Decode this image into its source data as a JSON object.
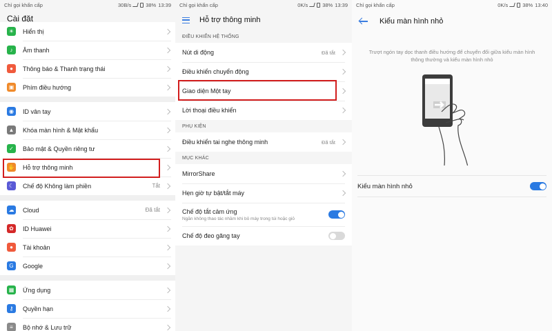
{
  "panel1": {
    "status": {
      "left": "Chỉ gọi khẩn cấp",
      "speed": "30B/s",
      "battery": "38%",
      "time": "13:39"
    },
    "title": "Cài đặt",
    "groups": [
      [
        {
          "label": "Hiển thị",
          "icon": "display-icon",
          "color": "#27b34b",
          "glyph": "☀"
        },
        {
          "label": "Âm thanh",
          "icon": "sound-icon",
          "color": "#27b34b",
          "glyph": "♪"
        },
        {
          "label": "Thông báo & Thanh trạng thái",
          "icon": "notification-icon",
          "color": "#f05a3c",
          "glyph": "●"
        },
        {
          "label": "Phím điều hướng",
          "icon": "nav-keys-icon",
          "color": "#f08a2a",
          "glyph": "▣"
        }
      ],
      [
        {
          "label": "ID vân tay",
          "icon": "fingerprint-icon",
          "color": "#2a7ae2",
          "glyph": "◉"
        },
        {
          "label": "Khóa màn hình & Mật khẩu",
          "icon": "lock-icon",
          "color": "#7a7a7a",
          "glyph": "▲"
        },
        {
          "label": "Bảo mật & Quyền riêng tư",
          "icon": "shield-icon",
          "color": "#27b34b",
          "glyph": "✓"
        },
        {
          "label": "Hỗ trợ thông minh",
          "icon": "hand-icon",
          "color": "#f08a2a",
          "glyph": "✋"
        },
        {
          "label": "Chế độ Không làm phiền",
          "icon": "moon-icon",
          "color": "#5a5ad6",
          "glyph": "☾",
          "value": "Tắt"
        }
      ],
      [
        {
          "label": "Cloud",
          "icon": "cloud-icon",
          "color": "#2a7ae2",
          "glyph": "☁",
          "value": "Đã tắt"
        },
        {
          "label": "ID Huawei",
          "icon": "huawei-icon",
          "color": "#d42828",
          "glyph": "✿"
        },
        {
          "label": "Tài khoản",
          "icon": "account-icon",
          "color": "#f05a3c",
          "glyph": "●"
        },
        {
          "label": "Google",
          "icon": "google-icon",
          "color": "#2a7ae2",
          "glyph": "G"
        }
      ],
      [
        {
          "label": "Ứng dụng",
          "icon": "apps-icon",
          "color": "#27b34b",
          "glyph": "▦"
        },
        {
          "label": "Quyền hạn",
          "icon": "key-icon",
          "color": "#2a7ae2",
          "glyph": "⚷"
        },
        {
          "label": "Bộ nhớ & Lưu trữ",
          "icon": "storage-icon",
          "color": "#8a8a8a",
          "glyph": "≡"
        }
      ]
    ]
  },
  "panel2": {
    "status": {
      "left": "Chỉ gọi khẩn cấp",
      "speed": "0K/s",
      "battery": "38%",
      "time": "13:39"
    },
    "title": "Hỗ trợ thông minh",
    "sections": [
      {
        "header": "ĐIỀU KHIỂN HỆ THỐNG",
        "rows": [
          {
            "label": "Nút di động",
            "value": "Đã tắt"
          },
          {
            "label": "Điều khiển chuyển động"
          },
          {
            "label": "Giao diện Một tay"
          },
          {
            "label": "Lời thoại điều khiển"
          }
        ]
      },
      {
        "header": "PHỤ KIỆN",
        "rows": [
          {
            "label": "Điều khiển tai nghe thông minh",
            "value": "Đã tắt"
          }
        ]
      },
      {
        "header": "MỤC KHÁC",
        "rows": [
          {
            "label": "MirrorShare"
          },
          {
            "label": "Hẹn giờ tự bật/tắt máy"
          },
          {
            "label": "Chế độ tắt cảm ứng",
            "sub": "Ngăn không thao tác nhầm khi bỏ máy trong túi hoặc giỏ",
            "toggle": true
          },
          {
            "label": "Chế độ đeo găng tay",
            "toggle": false
          }
        ]
      }
    ]
  },
  "panel3": {
    "status": {
      "left": "Chỉ gọi khẩn cấp",
      "speed": "0K/s",
      "battery": "38%",
      "time": "13:40"
    },
    "title": "Kiểu màn hình nhỏ",
    "description": "Trượt ngón tay dọc thanh điều hướng để chuyển đổi giữa kiểu màn hình thông thường và kiểu màn hình nhỏ",
    "setting": {
      "label": "Kiểu màn hình nhỏ",
      "toggle": true
    }
  },
  "colors": {
    "accent": "#2a7ae2",
    "highlight": "#d21c1c"
  }
}
